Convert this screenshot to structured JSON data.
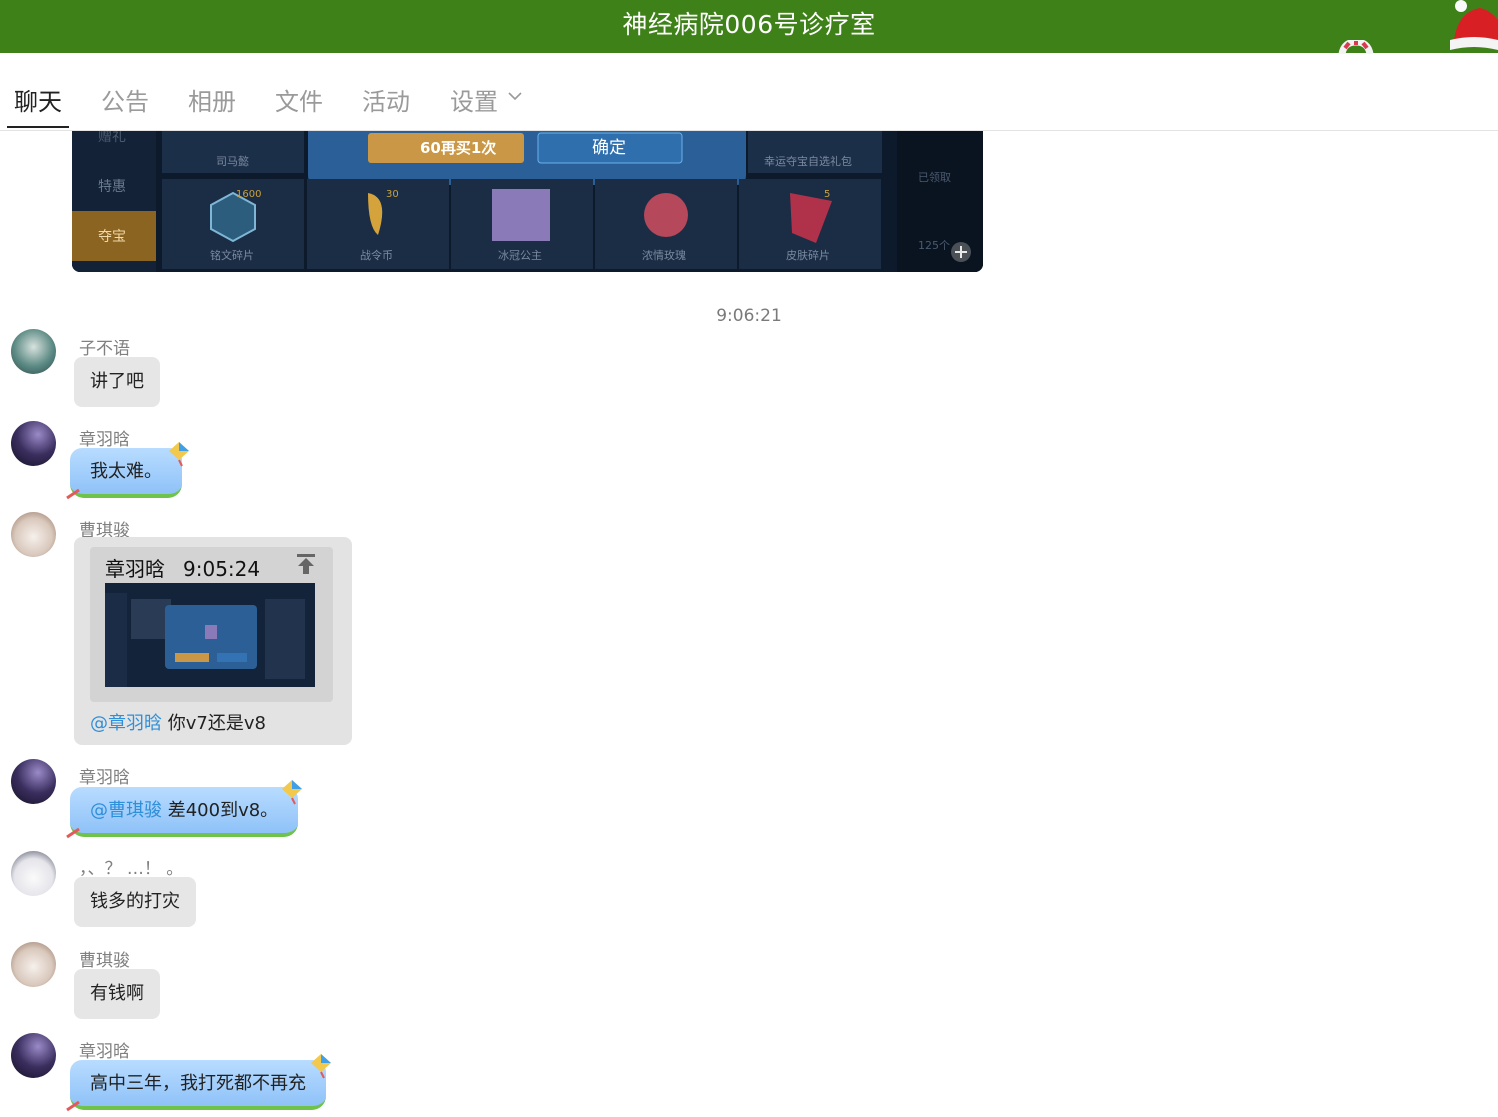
{
  "window": {
    "title": "神经病院006号诊疗室"
  },
  "tabs": [
    {
      "label": "聊天",
      "active": true
    },
    {
      "label": "公告",
      "active": false
    },
    {
      "label": "相册",
      "active": false
    },
    {
      "label": "文件",
      "active": false
    },
    {
      "label": "活动",
      "active": false
    },
    {
      "label": "设置",
      "active": false
    }
  ],
  "screenshot_game": {
    "buy_again": "60再买1次",
    "confirm": "确定",
    "sidebar": [
      "赠礼",
      "特惠",
      "夺宝"
    ],
    "items_top": [
      "司马懿",
      "幸运夺宝自选礼包"
    ],
    "items": [
      "铭文碎片",
      "战令币",
      "冰冠公主",
      "浓情玫瑰",
      "皮肤碎片"
    ],
    "badges": [
      "1600",
      "30",
      "5"
    ],
    "right": [
      "已领取",
      "125个"
    ]
  },
  "timestamp": "9:06:21",
  "messages": [
    {
      "sender": "子不语",
      "text": "讲了吧",
      "style": "gray"
    },
    {
      "sender": "章羽晗",
      "text": "我太难。",
      "style": "blue"
    },
    {
      "sender": "曹琪骏",
      "quote": {
        "author": "章羽晗",
        "time": "9:05:24"
      },
      "mention": "@章羽晗",
      "text": " 你v7还是v8",
      "style": "gray"
    },
    {
      "sender": "章羽晗",
      "mention": "@曹琪骏",
      "text": " 差400到v8。",
      "style": "blue"
    },
    {
      "sender": "，、？ …！ 。",
      "text": "钱多的打灾",
      "style": "gray"
    },
    {
      "sender": "曹琪骏",
      "text": "有钱啊",
      "style": "gray"
    },
    {
      "sender": "章羽晗",
      "text": "高中三年，我打死都不再充",
      "style": "blue"
    }
  ],
  "colors": {
    "titlebar": "#3f8119",
    "mention": "#2f8fd8",
    "bubble_gray": "#e6e6e6",
    "bubble_blue": "#9fcdfb"
  },
  "icons": [
    "santa-hat-icon",
    "candy-cane-icon",
    "chevron-down-icon",
    "pin-to-top-icon",
    "kite-icon"
  ]
}
